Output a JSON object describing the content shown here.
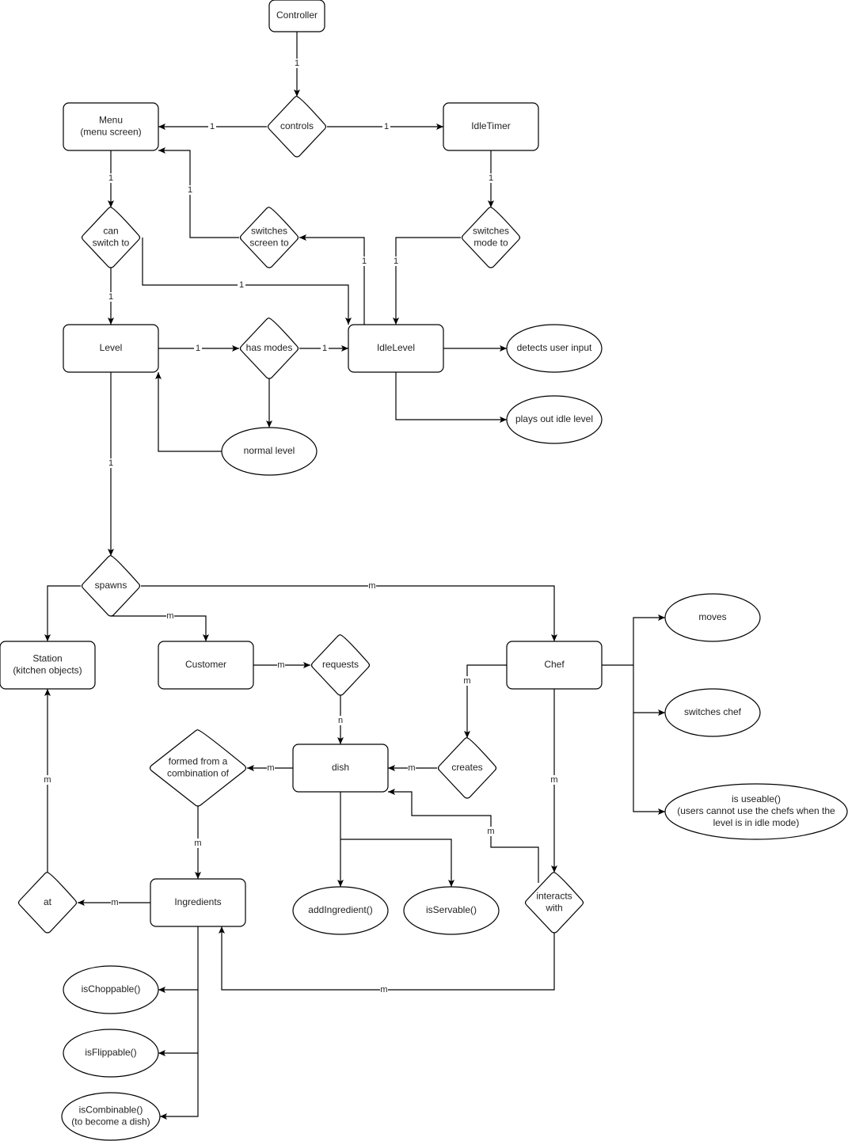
{
  "nodes": {
    "controller": {
      "shape": "rect",
      "lines": [
        "Controller"
      ]
    },
    "controls": {
      "shape": "diamond",
      "lines": [
        "controls"
      ]
    },
    "menu": {
      "shape": "rect",
      "lines": [
        "Menu",
        "(menu screen)"
      ]
    },
    "idletimer": {
      "shape": "rect",
      "lines": [
        "IdleTimer"
      ]
    },
    "can_switch_to": {
      "shape": "diamond",
      "lines": [
        "can",
        "switch to"
      ]
    },
    "switches_screen_to": {
      "shape": "diamond",
      "lines": [
        "switches",
        "screen to"
      ]
    },
    "switches_mode_to": {
      "shape": "diamond",
      "lines": [
        "switches",
        "mode to"
      ]
    },
    "level": {
      "shape": "rect",
      "lines": [
        "Level"
      ]
    },
    "has_modes": {
      "shape": "diamond",
      "lines": [
        "has modes"
      ]
    },
    "idlelevel": {
      "shape": "rect",
      "lines": [
        "IdleLevel"
      ]
    },
    "detects_user_input": {
      "shape": "ellipse",
      "lines": [
        "detects user input"
      ]
    },
    "plays_out_idle_level": {
      "shape": "ellipse",
      "lines": [
        "plays out idle level"
      ]
    },
    "normal_level": {
      "shape": "ellipse",
      "lines": [
        "normal level"
      ]
    },
    "spawns": {
      "shape": "diamond",
      "lines": [
        "spawns"
      ]
    },
    "station": {
      "shape": "rect",
      "lines": [
        "Station",
        "(kitchen objects)"
      ]
    },
    "customer": {
      "shape": "rect",
      "lines": [
        "Customer"
      ]
    },
    "requests": {
      "shape": "diamond",
      "lines": [
        "requests"
      ]
    },
    "chef": {
      "shape": "rect",
      "lines": [
        "Chef"
      ]
    },
    "moves": {
      "shape": "ellipse",
      "lines": [
        "moves"
      ]
    },
    "switches_chef": {
      "shape": "ellipse",
      "lines": [
        "switches chef"
      ]
    },
    "is_useable": {
      "shape": "ellipse",
      "lines": [
        "is useable()",
        "(users cannot use the chefs when the",
        "level is in idle mode)"
      ]
    },
    "formed_from": {
      "shape": "diamond",
      "lines": [
        "formed from a",
        "combination of"
      ]
    },
    "dish": {
      "shape": "rect",
      "lines": [
        "dish"
      ]
    },
    "creates": {
      "shape": "diamond",
      "lines": [
        "creates"
      ]
    },
    "ingredients": {
      "shape": "rect",
      "lines": [
        "Ingredients"
      ]
    },
    "at": {
      "shape": "diamond",
      "lines": [
        "at"
      ]
    },
    "add_ingredient": {
      "shape": "ellipse",
      "lines": [
        "addIngredient()"
      ]
    },
    "is_servable": {
      "shape": "ellipse",
      "lines": [
        "isServable()"
      ]
    },
    "interacts_with": {
      "shape": "diamond",
      "lines": [
        "interacts",
        "with"
      ]
    },
    "is_choppable": {
      "shape": "ellipse",
      "lines": [
        "isChoppable()"
      ]
    },
    "is_flippable": {
      "shape": "ellipse",
      "lines": [
        "isFlippable()"
      ]
    },
    "is_combinable": {
      "shape": "ellipse",
      "lines": [
        "isCombinable()",
        "(to become a dish)"
      ]
    }
  },
  "edges": [
    {
      "from": "controller",
      "to": "controls",
      "label": "1"
    },
    {
      "from": "controls",
      "to": "menu",
      "label": "1"
    },
    {
      "from": "controls",
      "to": "idletimer",
      "label": "1"
    },
    {
      "from": "menu",
      "to": "can_switch_to",
      "label": "1"
    },
    {
      "from": "idletimer",
      "to": "switches_mode_to",
      "label": "1"
    },
    {
      "from": "can_switch_to",
      "to": "level",
      "label": "1"
    },
    {
      "from": "can_switch_to",
      "to": "idlelevel",
      "label": "1"
    },
    {
      "from": "switches_screen_to",
      "to": "menu",
      "label": "1"
    },
    {
      "from": "idlelevel",
      "to": "switches_screen_to",
      "label": "1"
    },
    {
      "from": "switches_mode_to",
      "to": "idlelevel",
      "label": "1"
    },
    {
      "from": "level",
      "to": "has_modes",
      "label": "1"
    },
    {
      "from": "has_modes",
      "to": "idlelevel",
      "label": "1"
    },
    {
      "from": "idlelevel",
      "to": "detects_user_input",
      "label": ""
    },
    {
      "from": "idlelevel",
      "to": "plays_out_idle_level",
      "label": ""
    },
    {
      "from": "has_modes",
      "to": "normal_level",
      "label": ""
    },
    {
      "from": "normal_level",
      "to": "level",
      "label": ""
    },
    {
      "from": "level",
      "to": "spawns",
      "label": "1"
    },
    {
      "from": "spawns",
      "to": "station",
      "label": ""
    },
    {
      "from": "spawns",
      "to": "customer",
      "label": "m"
    },
    {
      "from": "spawns",
      "to": "chef",
      "label": "m"
    },
    {
      "from": "customer",
      "to": "requests",
      "label": "m"
    },
    {
      "from": "requests",
      "to": "dish",
      "label": "n"
    },
    {
      "from": "chef",
      "to": "creates",
      "label": "m"
    },
    {
      "from": "creates",
      "to": "dish",
      "label": "m"
    },
    {
      "from": "dish",
      "to": "formed_from",
      "label": "m"
    },
    {
      "from": "formed_from",
      "to": "ingredients",
      "label": "m"
    },
    {
      "from": "dish",
      "to": "add_ingredient",
      "label": ""
    },
    {
      "from": "dish",
      "to": "is_servable",
      "label": ""
    },
    {
      "from": "chef",
      "to": "interacts_with",
      "label": "m"
    },
    {
      "from": "interacts_with",
      "to": "dish",
      "label": "m"
    },
    {
      "from": "interacts_with",
      "to": "ingredients",
      "label": "m"
    },
    {
      "from": "ingredients",
      "to": "at",
      "label": "m"
    },
    {
      "from": "at",
      "to": "station",
      "label": "m"
    },
    {
      "from": "ingredients",
      "to": "is_choppable",
      "label": ""
    },
    {
      "from": "ingredients",
      "to": "is_flippable",
      "label": ""
    },
    {
      "from": "ingredients",
      "to": "is_combinable",
      "label": ""
    },
    {
      "from": "chef",
      "to": "moves",
      "label": ""
    },
    {
      "from": "chef",
      "to": "switches_chef",
      "label": ""
    },
    {
      "from": "chef",
      "to": "is_useable",
      "label": ""
    }
  ]
}
